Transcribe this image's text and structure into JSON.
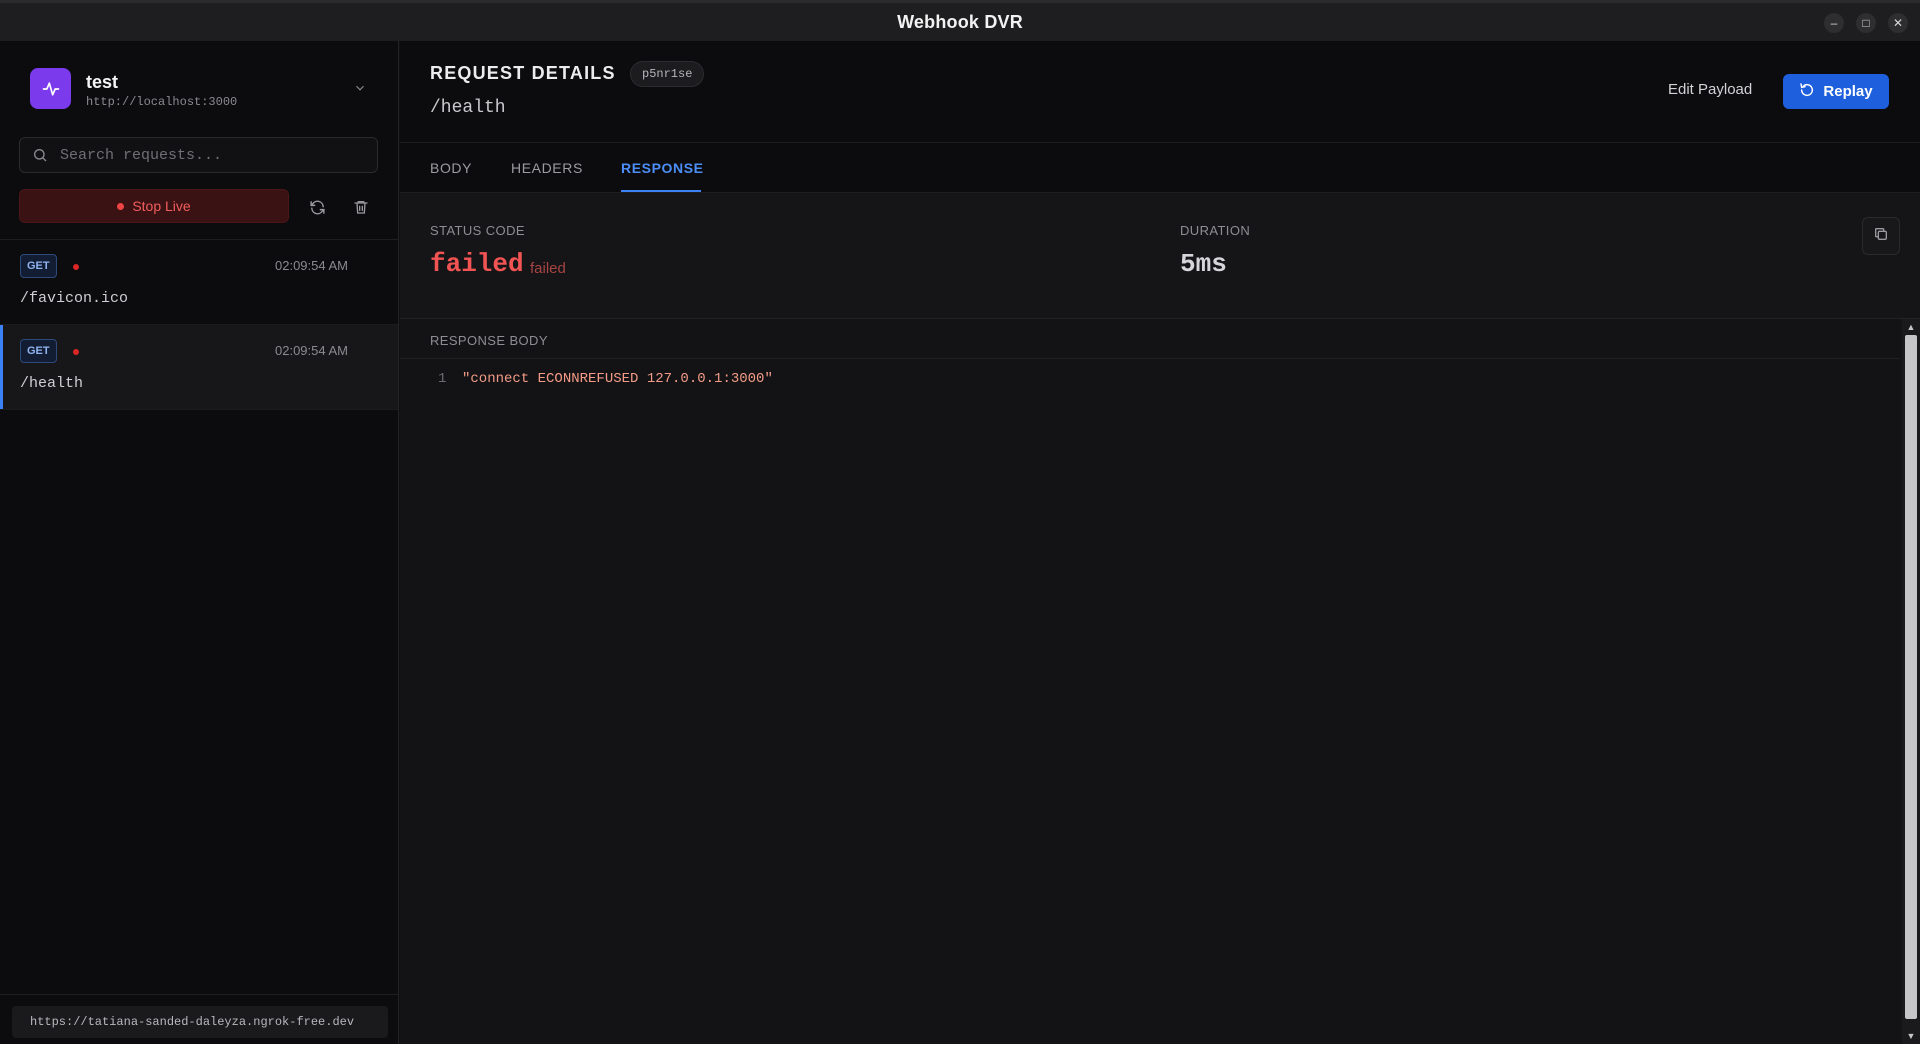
{
  "window": {
    "title": "Webhook DVR"
  },
  "project": {
    "name": "test",
    "url": "http://localhost:3000"
  },
  "search": {
    "placeholder": "Search requests..."
  },
  "live": {
    "label": "Stop Live"
  },
  "requests": [
    {
      "method": "GET",
      "time": "02:09:54 AM",
      "path": "/favicon.ico",
      "status_color": "#dc2626"
    },
    {
      "method": "GET",
      "time": "02:09:54 AM",
      "path": "/health",
      "status_color": "#dc2626",
      "active": true
    }
  ],
  "tunnel": {
    "url": "https://tatiana-sanded-daleyza.ngrok-free.dev"
  },
  "details": {
    "title": "REQUEST DETAILS",
    "id": "p5nr1se",
    "path": "/health",
    "edit_label": "Edit Payload",
    "replay_label": "Replay"
  },
  "tabs": [
    {
      "label": "BODY",
      "active": false
    },
    {
      "label": "HEADERS",
      "active": false
    },
    {
      "label": "RESPONSE",
      "active": true
    }
  ],
  "response": {
    "status_label": "STATUS CODE",
    "status_value": "failed",
    "status_sub": "failed",
    "duration_label": "DURATION",
    "duration_value": "5ms",
    "body_label": "RESPONSE BODY",
    "lines": [
      {
        "n": "1",
        "text": "\"connect ECONNREFUSED 127.0.0.1:3000\""
      }
    ]
  },
  "colors": {
    "accent": "#3b82f6",
    "error": "#ef4444",
    "brand": "#7c3aed"
  }
}
